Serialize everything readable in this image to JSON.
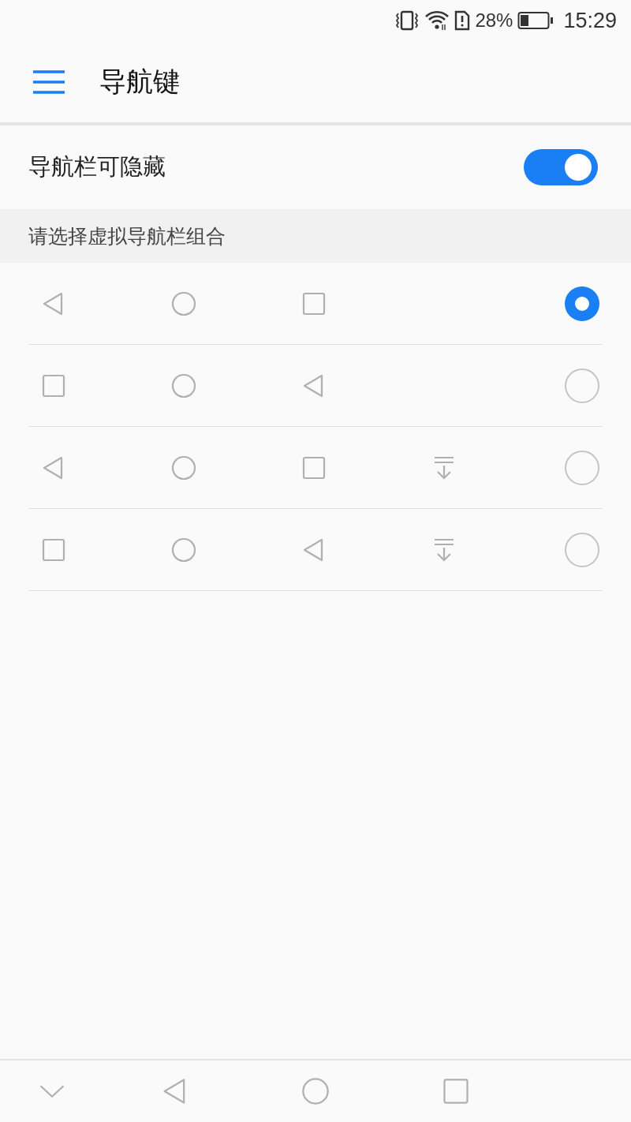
{
  "status_bar": {
    "battery_percent": "28%",
    "time": "15:29"
  },
  "app_bar": {
    "title": "导航键"
  },
  "hide_toggle": {
    "label": "导航栏可隐藏",
    "on": true
  },
  "section": {
    "title": "请选择虚拟导航栏组合"
  },
  "options": [
    {
      "keys": [
        {
          "kind": "back"
        },
        {
          "kind": "home"
        },
        {
          "kind": "recent"
        }
      ],
      "selected": true
    },
    {
      "keys": [
        {
          "kind": "recent"
        },
        {
          "kind": "home"
        },
        {
          "kind": "back"
        }
      ],
      "selected": false
    },
    {
      "keys": [
        {
          "kind": "back"
        },
        {
          "kind": "home"
        },
        {
          "kind": "recent"
        },
        {
          "kind": "hide"
        }
      ],
      "selected": false
    },
    {
      "keys": [
        {
          "kind": "recent"
        },
        {
          "kind": "home"
        },
        {
          "kind": "back"
        },
        {
          "kind": "hide"
        }
      ],
      "selected": false
    }
  ],
  "nav_bar": {
    "keys": [
      {
        "kind": "collapse"
      },
      {
        "kind": "back"
      },
      {
        "kind": "home"
      },
      {
        "kind": "recent"
      }
    ]
  }
}
